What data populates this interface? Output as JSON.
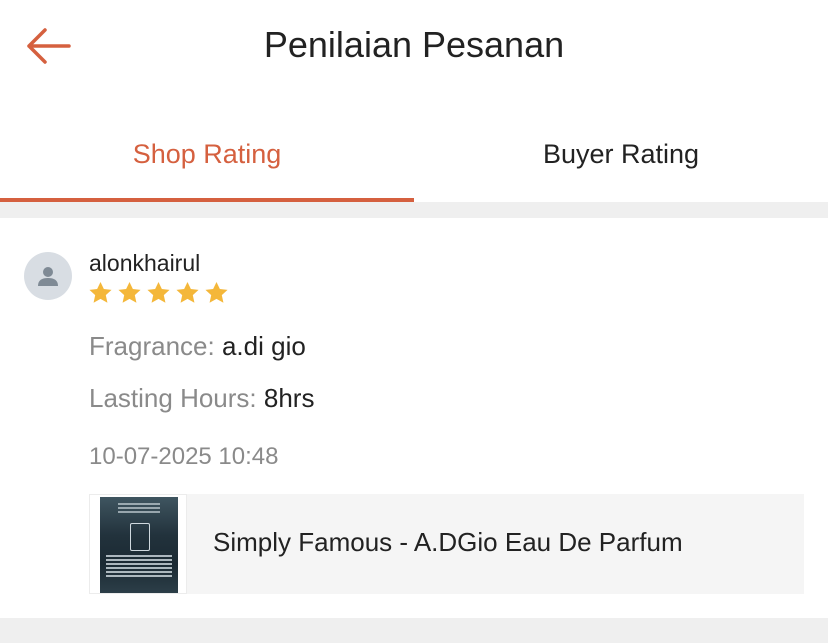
{
  "header": {
    "title": "Penilaian Pesanan",
    "back_icon": "arrow-left-icon",
    "accent_color": "#d5603f"
  },
  "tabs": [
    {
      "label": "Shop Rating",
      "active": true
    },
    {
      "label": "Buyer Rating",
      "active": false
    }
  ],
  "review": {
    "username": "alonkhairul",
    "rating": 5,
    "rating_max": 5,
    "star_color": "#f4b73a",
    "attributes": [
      {
        "label": "Fragrance:",
        "value": "a.di gio"
      },
      {
        "label": "Lasting Hours:",
        "value": "8hrs"
      }
    ],
    "timestamp": "10-07-2025 10:48",
    "product": {
      "name": "Simply Famous - A.DGio Eau De Parfum"
    }
  }
}
